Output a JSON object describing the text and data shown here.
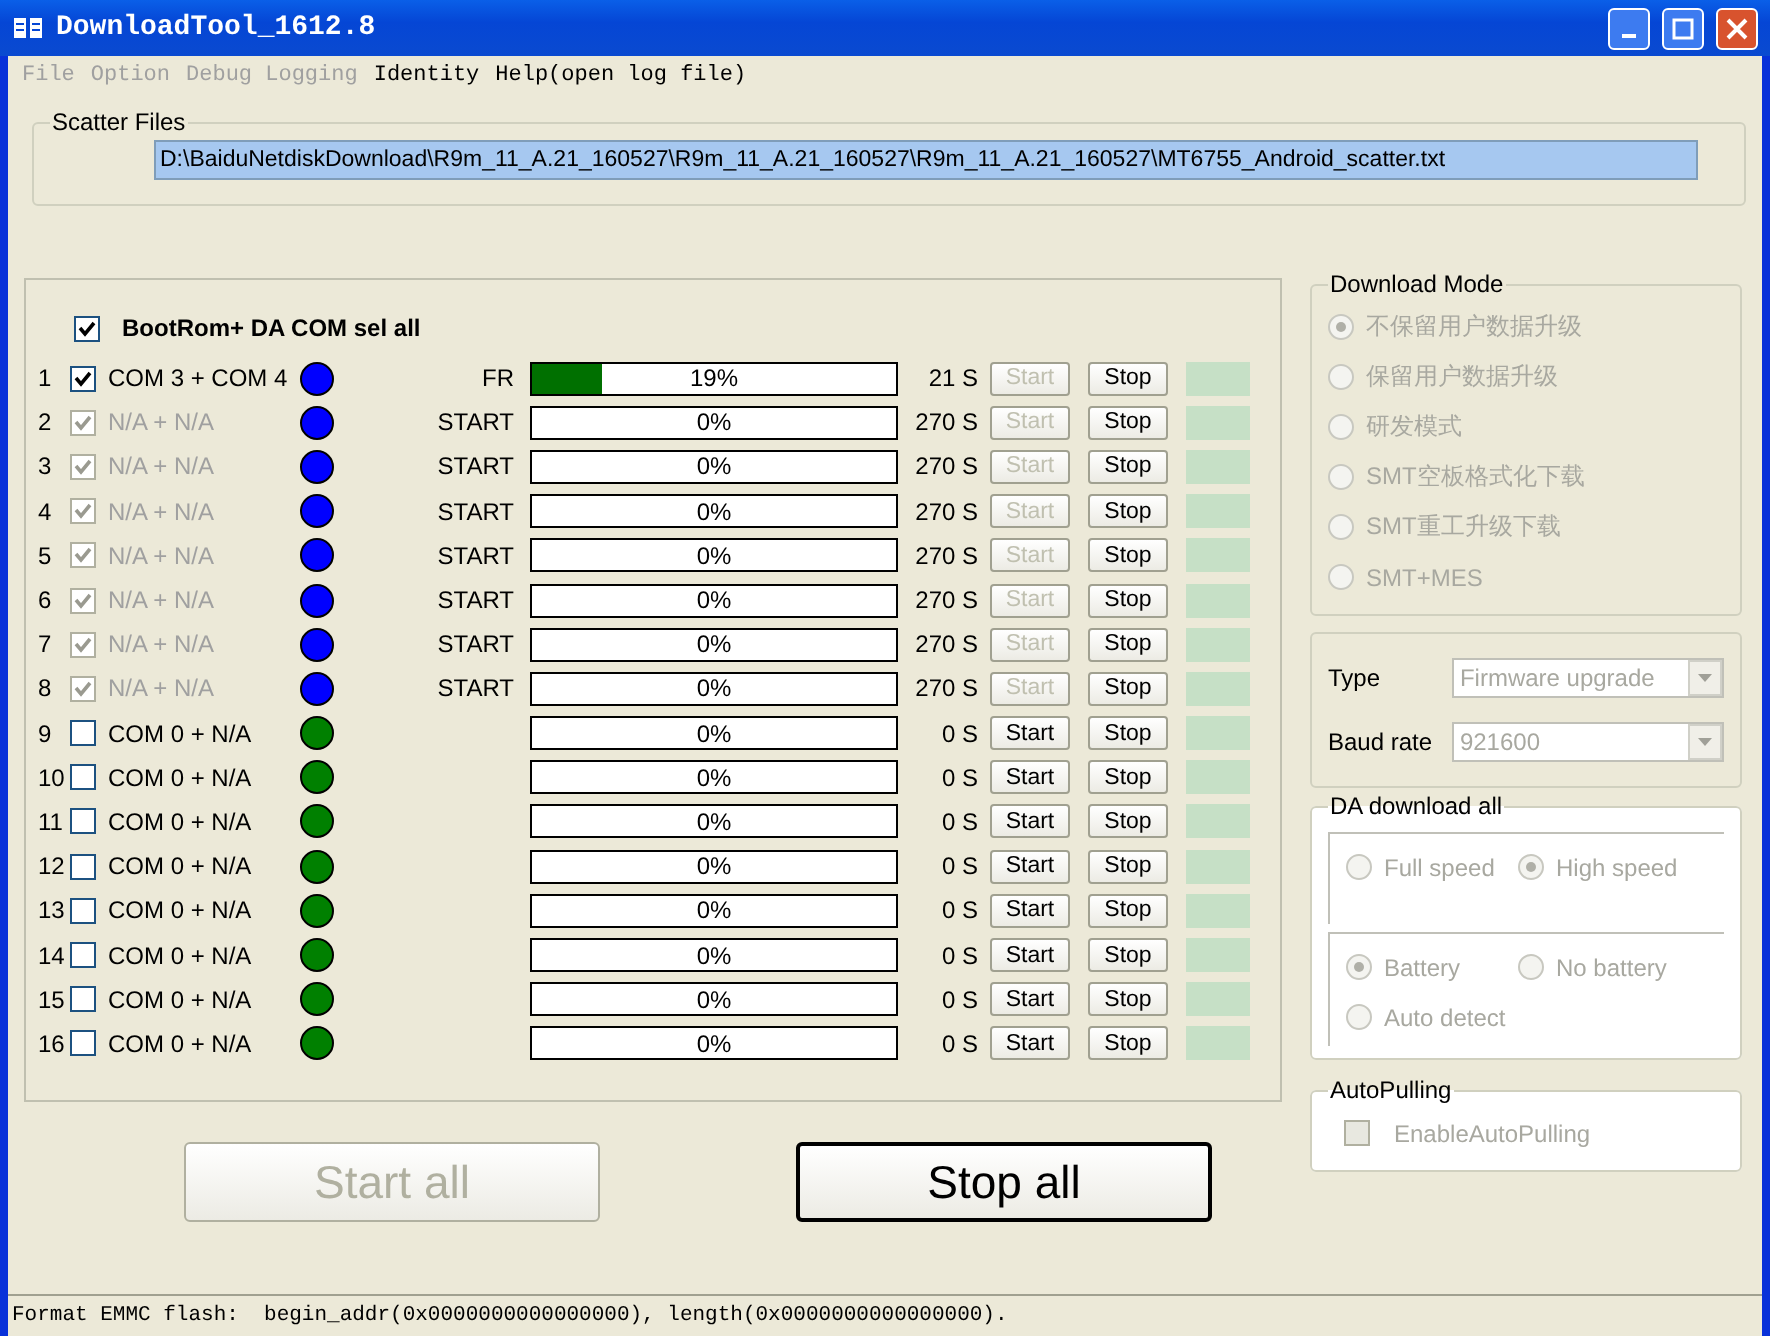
{
  "window": {
    "title": "DownloadTool_1612.8"
  },
  "menu": [
    {
      "label": "File",
      "disabled": true
    },
    {
      "label": "Option",
      "disabled": true
    },
    {
      "label": "Debug Logging",
      "disabled": true
    },
    {
      "label": "Identity",
      "disabled": false
    },
    {
      "label": "Help(open log file)",
      "disabled": false
    }
  ],
  "scatter": {
    "title": "Scatter Files",
    "path": "D:\\BaiduNetdiskDownload\\R9m_11_A.21_160527\\R9m_11_A.21_160527\\R9m_11_A.21_160527\\MT6755_Android_scatter.txt"
  },
  "ports": {
    "sel_all": {
      "label": "BootRom+ DA COM sel all",
      "checked": true
    },
    "rows": [
      {
        "num": "1",
        "checked": true,
        "disabled": false,
        "com": "COM 3 + COM 4",
        "color": "#0000ff",
        "stage": "FR",
        "level": 0.19,
        "percent": "19%",
        "time": "21 S",
        "start": "Start",
        "start_disabled": true,
        "stop": "Stop"
      },
      {
        "num": "2",
        "checked": true,
        "disabled": true,
        "com": "N/A + N/A",
        "color": "#0000ff",
        "stage": "START",
        "level": 0,
        "percent": "0%",
        "time": "270 S",
        "start": "Start",
        "start_disabled": true,
        "stop": "Stop"
      },
      {
        "num": "3",
        "checked": true,
        "disabled": true,
        "com": "N/A + N/A",
        "color": "#0000ff",
        "stage": "START",
        "level": 0,
        "percent": "0%",
        "time": "270 S",
        "start": "Start",
        "start_disabled": true,
        "stop": "Stop"
      },
      {
        "num": "4",
        "checked": true,
        "disabled": true,
        "com": "N/A + N/A",
        "color": "#0000ff",
        "stage": "START",
        "level": 0,
        "percent": "0%",
        "time": "270 S",
        "start": "Start",
        "start_disabled": true,
        "stop": "Stop"
      },
      {
        "num": "5",
        "checked": true,
        "disabled": true,
        "com": "N/A + N/A",
        "color": "#0000ff",
        "stage": "START",
        "level": 0,
        "percent": "0%",
        "time": "270 S",
        "start": "Start",
        "start_disabled": true,
        "stop": "Stop"
      },
      {
        "num": "6",
        "checked": true,
        "disabled": true,
        "com": "N/A + N/A",
        "color": "#0000ff",
        "stage": "START",
        "level": 0,
        "percent": "0%",
        "time": "270 S",
        "start": "Start",
        "start_disabled": true,
        "stop": "Stop"
      },
      {
        "num": "7",
        "checked": true,
        "disabled": true,
        "com": "N/A + N/A",
        "color": "#0000ff",
        "stage": "START",
        "level": 0,
        "percent": "0%",
        "time": "270 S",
        "start": "Start",
        "start_disabled": true,
        "stop": "Stop"
      },
      {
        "num": "8",
        "checked": true,
        "disabled": true,
        "com": "N/A + N/A",
        "color": "#0000ff",
        "stage": "START",
        "level": 0,
        "percent": "0%",
        "time": "270 S",
        "start": "Start",
        "start_disabled": true,
        "stop": "Stop"
      },
      {
        "num": "9",
        "checked": false,
        "disabled": false,
        "com": "COM 0 + N/A",
        "color": "#008000",
        "level": 0,
        "percent": "0%",
        "time": "0 S",
        "start": "Start",
        "start_disabled": false,
        "stop": "Stop"
      },
      {
        "num": "10",
        "checked": false,
        "disabled": false,
        "com": "COM 0 + N/A",
        "color": "#008000",
        "level": 0,
        "percent": "0%",
        "time": "0 S",
        "start": "Start",
        "start_disabled": false,
        "stop": "Stop"
      },
      {
        "num": "11",
        "checked": false,
        "disabled": false,
        "com": "COM 0 + N/A",
        "color": "#008000",
        "level": 0,
        "percent": "0%",
        "time": "0 S",
        "start": "Start",
        "start_disabled": false,
        "stop": "Stop"
      },
      {
        "num": "12",
        "checked": false,
        "disabled": false,
        "com": "COM 0 + N/A",
        "color": "#008000",
        "level": 0,
        "percent": "0%",
        "time": "0 S",
        "start": "Start",
        "start_disabled": false,
        "stop": "Stop"
      },
      {
        "num": "13",
        "checked": false,
        "disabled": false,
        "com": "COM 0 + N/A",
        "color": "#008000",
        "level": 0,
        "percent": "0%",
        "time": "0 S",
        "start": "Start",
        "start_disabled": false,
        "stop": "Stop"
      },
      {
        "num": "14",
        "checked": false,
        "disabled": false,
        "com": "COM 0 + N/A",
        "color": "#008000",
        "level": 0,
        "percent": "0%",
        "time": "0 S",
        "start": "Start",
        "start_disabled": false,
        "stop": "Stop"
      },
      {
        "num": "15",
        "checked": false,
        "disabled": false,
        "com": "COM 0 + N/A",
        "color": "#008000",
        "level": 0,
        "percent": "0%",
        "time": "0 S",
        "start": "Start",
        "start_disabled": false,
        "stop": "Stop"
      },
      {
        "num": "16",
        "checked": false,
        "disabled": false,
        "com": "COM 0 + N/A",
        "color": "#008000",
        "level": 0,
        "percent": "0%",
        "time": "0 S",
        "start": "Start",
        "start_disabled": false,
        "stop": "Stop"
      }
    ]
  },
  "actions": {
    "start_all": {
      "label": "Start all",
      "disabled": true
    },
    "stop_all": {
      "label": "Stop all",
      "disabled": false
    }
  },
  "download_mode": {
    "title": "Download Mode",
    "disabled": true,
    "options": [
      {
        "label": "不保留用户数据升级",
        "selected": true
      },
      {
        "label": "保留用户数据升级",
        "selected": false
      },
      {
        "label": "研发模式",
        "selected": false
      },
      {
        "label": "SMT空板格式化下载",
        "selected": false
      },
      {
        "label": "SMT重工升级下载",
        "selected": false
      },
      {
        "label": "SMT+MES",
        "selected": false
      }
    ]
  },
  "settings": {
    "disabled": true,
    "fields": [
      {
        "label": "Type",
        "value": "Firmware upgrade"
      },
      {
        "label": "Baud rate",
        "value": "921600"
      }
    ]
  },
  "da_download": {
    "title": "DA download all",
    "disabled": true,
    "speed": [
      {
        "label": "Full speed",
        "selected": false
      },
      {
        "label": "High speed",
        "selected": true
      }
    ],
    "battery": [
      {
        "label": "Battery",
        "selected": true
      },
      {
        "label": "No battery",
        "selected": false
      },
      {
        "label": "Auto detect",
        "selected": false
      }
    ]
  },
  "auto_pulling": {
    "title": "AutoPulling",
    "label": "EnableAutoPulling",
    "checked": false,
    "disabled": true
  },
  "status_bar": {
    "text": "Format EMMC flash:  begin_addr(0x0000000000000000), length(0x0000000000000000)."
  }
}
